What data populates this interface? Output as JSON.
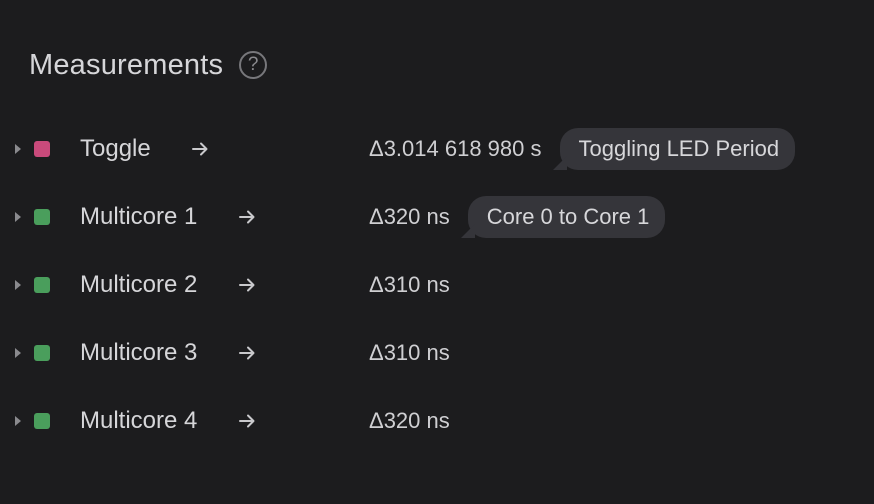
{
  "header": {
    "title": "Measurements",
    "help_glyph": "?"
  },
  "measurements": [
    {
      "name": "Toggle",
      "color": "#c94a7b",
      "delta": "Δ3.014 618 980 s",
      "note": "Toggling LED Period"
    },
    {
      "name": "Multicore 1",
      "color": "#4a9e5c",
      "delta": "Δ320 ns",
      "note": "Core 0 to Core 1"
    },
    {
      "name": "Multicore 2",
      "color": "#4a9e5c",
      "delta": "Δ310 ns",
      "note": ""
    },
    {
      "name": "Multicore 3",
      "color": "#4a9e5c",
      "delta": "Δ310 ns",
      "note": ""
    },
    {
      "name": "Multicore 4",
      "color": "#4a9e5c",
      "delta": "Δ320 ns",
      "note": ""
    }
  ],
  "icons": {
    "help": "help-icon",
    "expand": "caret-right-icon",
    "navigate": "arrow-right-icon"
  }
}
